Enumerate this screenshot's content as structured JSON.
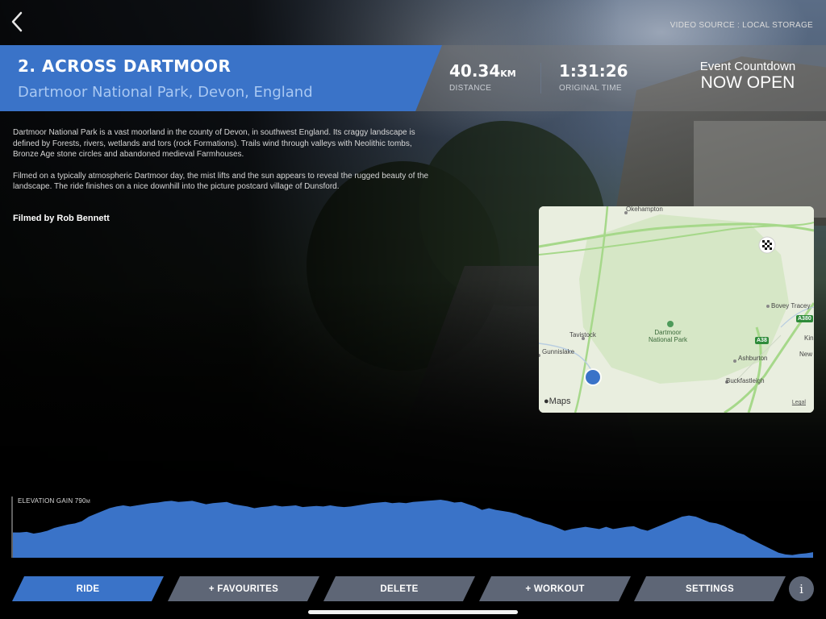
{
  "header": {
    "video_source": "VIDEO SOURCE : LOCAL STORAGE"
  },
  "route": {
    "title": "2. ACROSS DARTMOOR",
    "location": "Dartmoor National Park, Devon, England"
  },
  "stats": {
    "distance_value": "40.34",
    "distance_unit": "KM",
    "distance_label": "DISTANCE",
    "time_value": "1:31:26",
    "time_label": "ORIGINAL TIME"
  },
  "countdown": {
    "label": "Event Countdown",
    "status": "NOW OPEN"
  },
  "description": {
    "paragraph1": "Dartmoor National Park is a vast moorland in the county of Devon, in southwest England. Its craggy landscape is defined by Forests, rivers, wetlands and tors (rock Formations). Trails wind through valleys with Neolithic tombs, Bronze Age stone circles and abandoned medieval Farmhouses.",
    "paragraph2": "Filmed on a typically atmospheric Dartmoor day, the mist lifts and the sun appears to reveal the rugged beauty of the landscape. The ride finishes on a nice downhill into the picture postcard village of Dunsford.",
    "credit": "Filmed by Rob Bennett"
  },
  "map": {
    "labels": {
      "okehampton": "Okehampton",
      "bovey_tracey": "Bovey Tracey",
      "tavistock": "Tavistock",
      "park": "Dartmoor National Park",
      "gunnislake": "Gunnislake",
      "ashburton": "Ashburton",
      "buckfastleigh": "Buckfastleigh",
      "newton": "New",
      "kings": "Kin"
    },
    "road_badges": {
      "a38": "A38",
      "a380": "A380"
    },
    "brand": "Maps",
    "legal": "Legal",
    "colors": {
      "land": "#e9eedf",
      "park": "#d4e6c3",
      "roads": "#a6d88a",
      "marker": "#3a73c8"
    }
  },
  "elevation": {
    "label": "ELEVATION GAIN",
    "value": "790",
    "unit": "M",
    "fill_color": "#3a73c8",
    "profile": [
      0.58,
      0.58,
      0.57,
      0.6,
      0.58,
      0.55,
      0.5,
      0.47,
      0.44,
      0.42,
      0.38,
      0.3,
      0.25,
      0.2,
      0.15,
      0.12,
      0.1,
      0.12,
      0.1,
      0.08,
      0.06,
      0.05,
      0.03,
      0.02,
      0.04,
      0.03,
      0.02,
      0.05,
      0.08,
      0.06,
      0.05,
      0.04,
      0.08,
      0.1,
      0.12,
      0.15,
      0.13,
      0.12,
      0.1,
      0.12,
      0.11,
      0.1,
      0.13,
      0.12,
      0.11,
      0.12,
      0.1,
      0.12,
      0.13,
      0.12,
      0.1,
      0.08,
      0.06,
      0.05,
      0.04,
      0.06,
      0.05,
      0.06,
      0.04,
      0.03,
      0.02,
      0.01,
      0.0,
      0.02,
      0.05,
      0.04,
      0.08,
      0.12,
      0.18,
      0.15,
      0.18,
      0.2,
      0.22,
      0.25,
      0.3,
      0.33,
      0.38,
      0.42,
      0.45,
      0.5,
      0.55,
      0.52,
      0.5,
      0.48,
      0.5,
      0.52,
      0.48,
      0.52,
      0.5,
      0.48,
      0.47,
      0.52,
      0.55,
      0.5,
      0.45,
      0.4,
      0.35,
      0.3,
      0.28,
      0.3,
      0.35,
      0.4,
      0.42,
      0.46,
      0.52,
      0.58,
      0.62,
      0.7,
      0.76,
      0.82,
      0.88,
      0.94,
      0.97,
      0.98,
      0.96,
      0.95,
      0.93
    ]
  },
  "buttons": {
    "ride": "RIDE",
    "favourites": "+ FAVOURITES",
    "delete": "DELETE",
    "workout": "+ WORKOUT",
    "settings": "SETTINGS",
    "info": "i"
  }
}
